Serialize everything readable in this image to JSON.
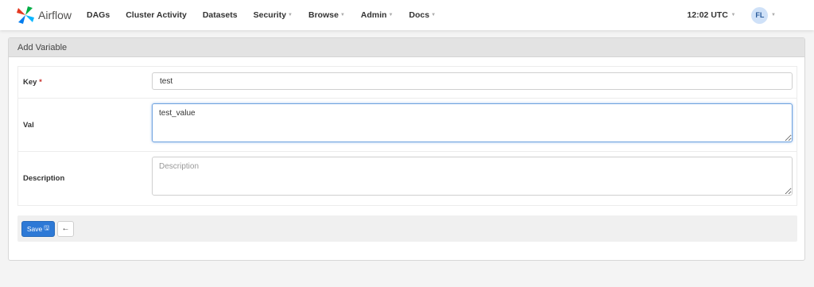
{
  "navbar": {
    "brand": "Airflow",
    "items": [
      {
        "label": "DAGs",
        "dropdown": false
      },
      {
        "label": "Cluster Activity",
        "dropdown": false
      },
      {
        "label": "Datasets",
        "dropdown": false
      },
      {
        "label": "Security",
        "dropdown": true
      },
      {
        "label": "Browse",
        "dropdown": true
      },
      {
        "label": "Admin",
        "dropdown": true
      },
      {
        "label": "Docs",
        "dropdown": true
      }
    ],
    "time": "12:02 UTC",
    "user_initials": "FL"
  },
  "panel": {
    "title": "Add Variable",
    "fields": {
      "key": {
        "label": "Key",
        "required_mark": "*",
        "value": "test"
      },
      "val": {
        "label": "Val",
        "value": "test_value"
      },
      "description": {
        "label": "Description",
        "value": "",
        "placeholder": "Description"
      }
    },
    "actions": {
      "save_label": "Save",
      "save_icon": "floppy-disk-icon",
      "back_icon": "arrow-left-icon"
    }
  },
  "colors": {
    "primary": "#2d79d6",
    "required": "#c9302c",
    "panel_header": "#e3e3e3"
  }
}
